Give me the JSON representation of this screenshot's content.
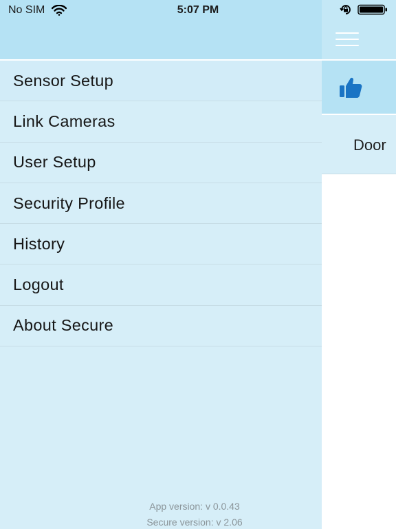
{
  "status_bar": {
    "carrier": "No SIM",
    "time": "5:07 PM",
    "icons": [
      "wifi-icon",
      "rotation-lock-icon",
      "battery-icon"
    ]
  },
  "menu": {
    "items": [
      {
        "label": "Sensor Setup"
      },
      {
        "label": "Link Cameras"
      },
      {
        "label": "User Setup"
      },
      {
        "label": "Security Profile"
      },
      {
        "label": "History"
      },
      {
        "label": "Logout"
      },
      {
        "label": "About Secure"
      }
    ]
  },
  "versions": {
    "app": "App version: v 0.0.43",
    "secure": "Secure version: v 2.06"
  },
  "main": {
    "navbar_icon": "hamburger-menu-icon",
    "status_icon": "thumbs-up-icon",
    "sensor_label": "Door"
  },
  "colors": {
    "drawer_bg": "#d6eef8",
    "header_bg": "#b5e2f4",
    "accent_icon": "#1a74c4",
    "text": "#161616",
    "version_text": "#8a9499"
  }
}
